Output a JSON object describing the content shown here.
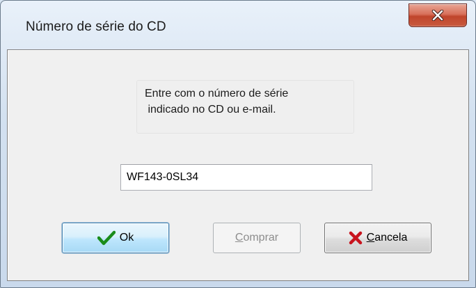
{
  "window": {
    "title": "Número de série do CD"
  },
  "message": {
    "line1": "Entre com o número de série",
    "line2": " indicado no CD ou e-mail."
  },
  "serial_field": {
    "value": "WF143-0SL34"
  },
  "buttons": {
    "ok": {
      "label": "Ok",
      "icon": "check-icon",
      "enabled": true
    },
    "buy": {
      "label_mnemonic": "C",
      "label_rest": "omprar",
      "enabled": false
    },
    "cancel": {
      "label_mnemonic": "C",
      "label_rest": "ancela",
      "icon": "x-icon",
      "enabled": true
    }
  },
  "colors": {
    "check_icon": "#1a8c1a",
    "cancel_icon": "#c8141e",
    "close_button": "#c8452c"
  }
}
